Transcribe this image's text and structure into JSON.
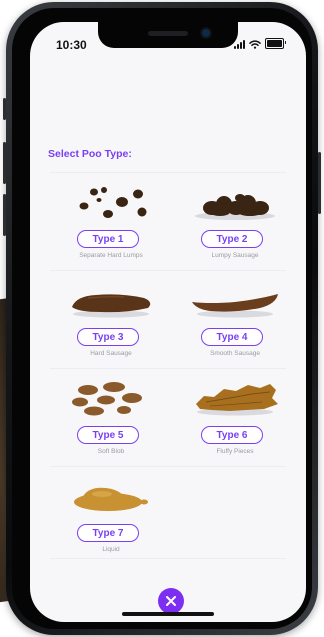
{
  "status_bar": {
    "time": "10:30"
  },
  "title": "Select Poo Type:",
  "types": [
    {
      "label": "Type 1",
      "description": "Separate Hard Lumps",
      "icon": "hard-lumps-icon"
    },
    {
      "label": "Type 2",
      "description": "Lumpy Sausage",
      "icon": "lumpy-sausage-icon"
    },
    {
      "label": "Type 3",
      "description": "Hard Sausage",
      "icon": "hard-sausage-icon"
    },
    {
      "label": "Type 4",
      "description": "Smooth Sausage",
      "icon": "smooth-sausage-icon"
    },
    {
      "label": "Type 5",
      "description": "Soft Blob",
      "icon": "soft-blob-icon"
    },
    {
      "label": "Type 6",
      "description": "Fluffy Pieces",
      "icon": "fluffy-pieces-icon"
    },
    {
      "label": "Type 7",
      "description": "Liquid",
      "icon": "liquid-icon"
    }
  ],
  "colors": {
    "accent": "#7b3ff2",
    "close_button": "#7c2ff0",
    "screen_background": "#f7f7f9",
    "dark_brown": "#3a2414",
    "medium_brown": "#8b5a2b",
    "light_brown": "#c89232"
  },
  "close_icon": "close-icon"
}
